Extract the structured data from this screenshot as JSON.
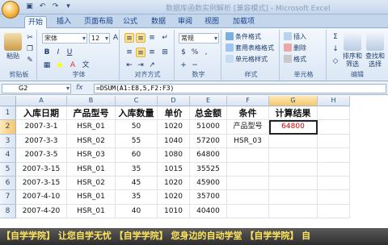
{
  "app": {
    "title": "数据库函数实例解析 [兼容模式] - Microsoft Excel"
  },
  "qat": [
    "save-icon",
    "undo-icon",
    "redo-icon",
    "customize-icon"
  ],
  "tabs": [
    "开始",
    "插入",
    "页面布局",
    "公式",
    "数据",
    "审阅",
    "视图",
    "加载项"
  ],
  "ribbon": {
    "paste_label": "粘贴",
    "clipboard_label": "剪贴板",
    "font_name": "宋体",
    "font_size": "12",
    "font_group_label": "字体",
    "align_group_label": "对齐方式",
    "number_format": "常规",
    "number_group_label": "数字",
    "styles": [
      "条件格式",
      "套用表格格式",
      "单元格样式"
    ],
    "styles_group_label": "样式",
    "cells": [
      "插入",
      "删除",
      "格式"
    ],
    "cells_group_label": "单元格",
    "editing": [
      "排序和筛选",
      "查找和选择"
    ],
    "editing_group_label": "编辑",
    "font_color": "#e03020",
    "fill_color": "#ffff00"
  },
  "formula_bar": {
    "name_box": "G2",
    "fx": "fx",
    "formula": "=DSUM(A1:E8,5,F2:F3)"
  },
  "sheet": {
    "columns": [
      "A",
      "B",
      "C",
      "D",
      "E",
      "F",
      "G",
      "H"
    ],
    "selected_column": "G",
    "rows": [
      "1",
      "2",
      "3",
      "4",
      "5",
      "6",
      "7",
      "8"
    ],
    "selected_row": "2",
    "header": [
      "入库日期",
      "产品型号",
      "入库数量",
      "单价",
      "总金额",
      "条件",
      "计算结果",
      ""
    ],
    "data": [
      [
        "2007-3-1",
        "HSR_01",
        "50",
        "1020",
        "51000",
        "产品型号",
        "64800",
        ""
      ],
      [
        "2007-3-3",
        "HSR_02",
        "55",
        "1040",
        "57200",
        "HSR_03",
        "",
        ""
      ],
      [
        "2007-3-5",
        "HSR_03",
        "60",
        "1080",
        "64800",
        "",
        "",
        ""
      ],
      [
        "2007-3-15",
        "HSR_01",
        "35",
        "1015",
        "35525",
        "",
        "",
        ""
      ],
      [
        "2007-3-15",
        "HSR_02",
        "45",
        "1020",
        "45900",
        "",
        "",
        ""
      ],
      [
        "2007-4-10",
        "HSR_01",
        "35",
        "1020",
        "35700",
        "",
        "",
        ""
      ],
      [
        "2007-4-20",
        "HSR_01",
        "40",
        "1010",
        "40400",
        "",
        "",
        ""
      ]
    ],
    "result_color": "#dd0000"
  },
  "watermark": "【自学学院】 让您自学无忧 【自学学院】 您身边的自动学堂 【自学学院】 自"
}
